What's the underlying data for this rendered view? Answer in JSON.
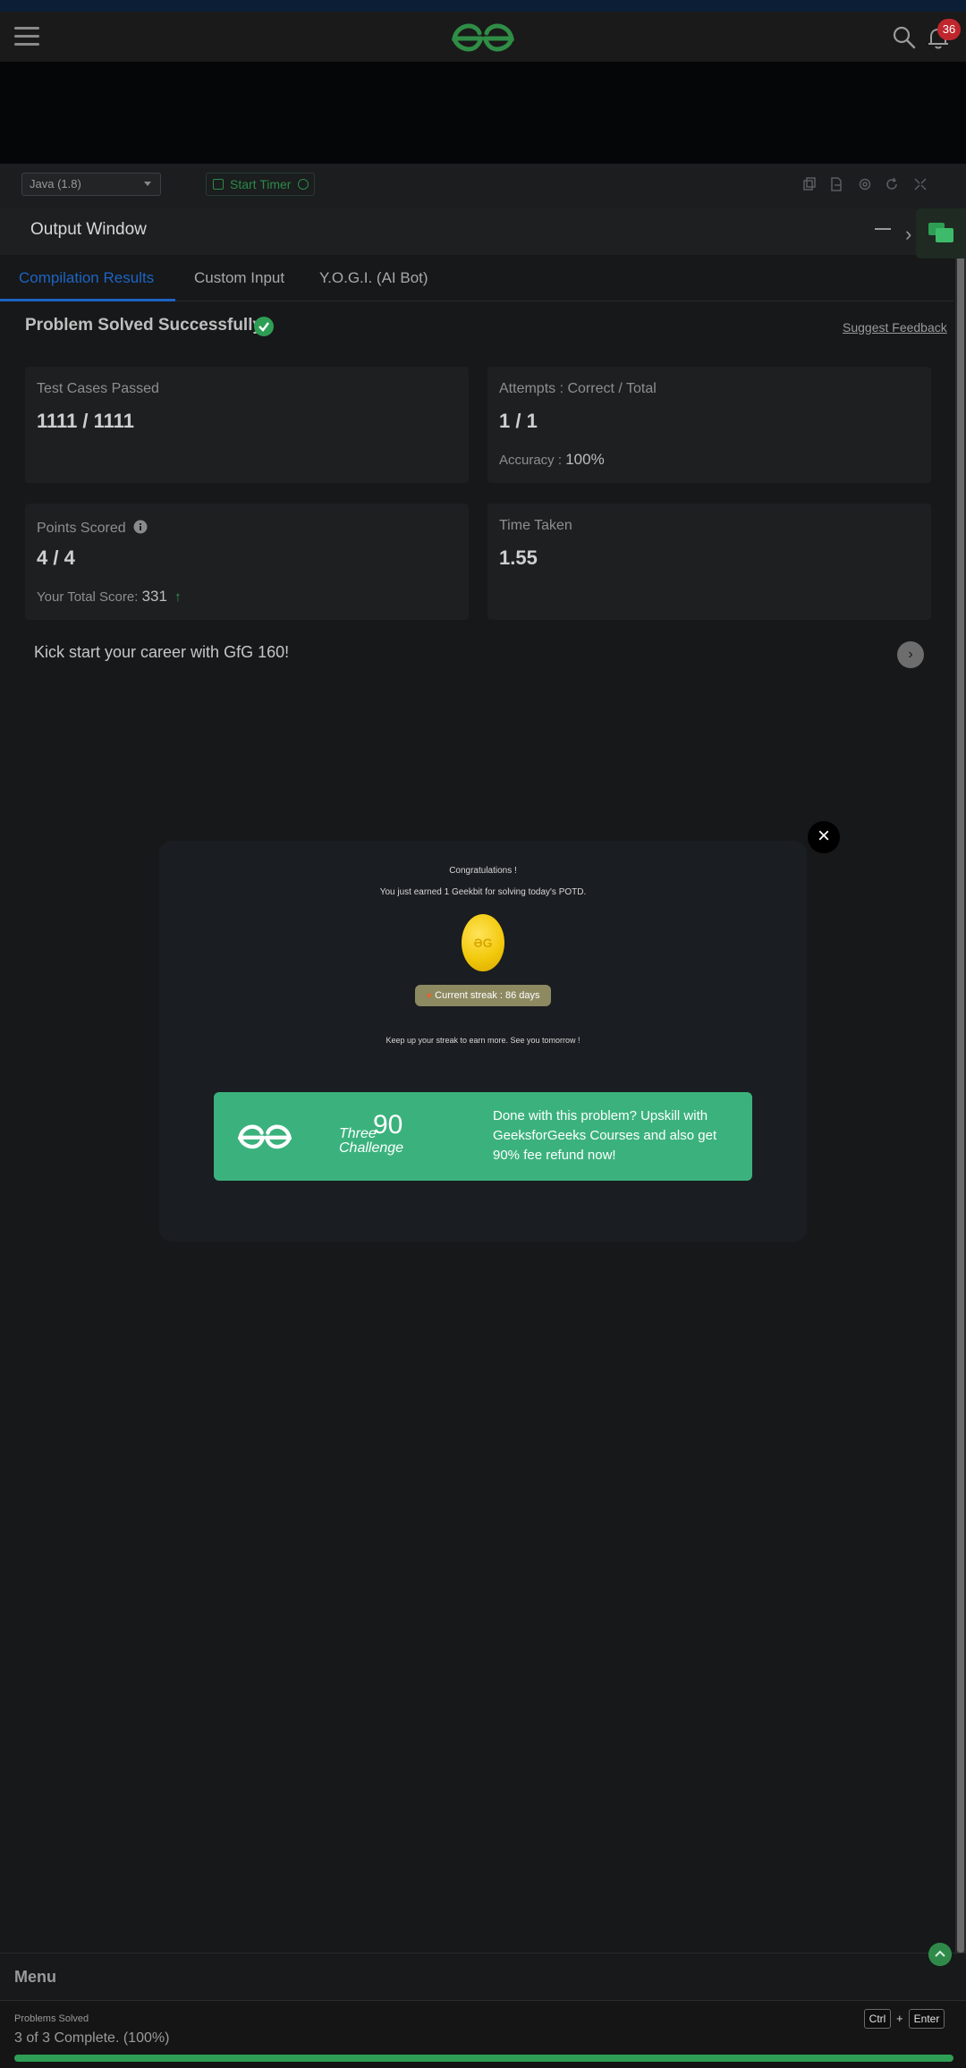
{
  "header": {
    "notification_count": "36",
    "logo_icon": "gfg-logo-icon",
    "search_icon": "search-icon",
    "bell_icon": "bell-icon"
  },
  "toolbar": {
    "language": "Java (1.8)",
    "timer_label": "Start Timer"
  },
  "output": {
    "title": "Output Window",
    "tabs": [
      "Compilation Results",
      "Custom Input",
      "Y.O.G.I. (AI Bot)"
    ],
    "status": "Problem Solved Successfully",
    "feedback": "Suggest Feedback",
    "cards": {
      "tests": {
        "label": "Test Cases Passed",
        "value": "1111 / 1111"
      },
      "attempts": {
        "label": "Attempts : Correct / Total",
        "value": "1 / 1",
        "sub_label": "Accuracy :",
        "sub_value": "100%"
      },
      "points": {
        "label": "Points Scored",
        "value": "4 / 4",
        "sub_label": "Your Total Score:",
        "sub_value": "331"
      },
      "time": {
        "label": "Time Taken",
        "value": "1.55"
      }
    },
    "career": "Kick start your career with GfG 160!"
  },
  "modal": {
    "congrats": "Congratulations !",
    "earned": "You just earned 1 Geekbit for solving today's POTD.",
    "streak": "Current streak : 86 days",
    "keepup": "Keep up your streak to earn more. See you tomorrow !",
    "banner_brand": "Three",
    "banner_number": "90",
    "banner_word": "Challenge",
    "banner_text": "Done with this problem? Upskill with GeeksforGeeks Courses and also get 90% fee refund now!"
  },
  "menu": {
    "label": "Menu",
    "progress_label": "Problems Solved",
    "progress_text": "3 of 3 Complete. (100%)",
    "progress_fraction": 1.0,
    "shortcut_ctrl": "Ctrl",
    "shortcut_plus": "+",
    "shortcut_enter": "Enter"
  },
  "colors": {
    "accent_green": "#2f9e55",
    "banner_green": "#3bb27d",
    "tab_blue": "#1c64c4"
  }
}
